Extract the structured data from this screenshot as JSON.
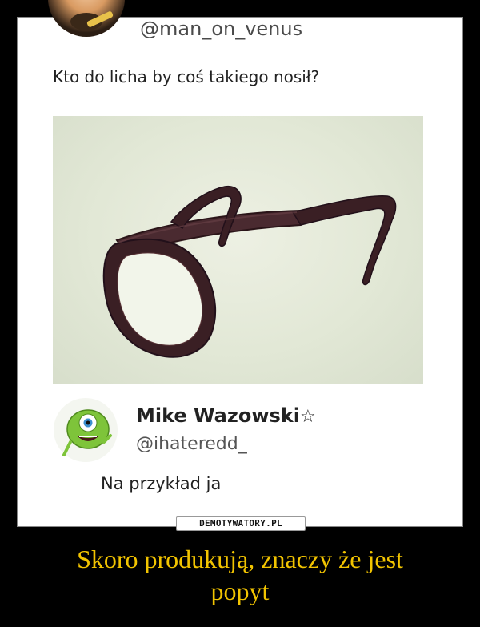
{
  "post": {
    "author_handle": "@man_on_venus",
    "text": "Kto do licha by coś takiego nosił?"
  },
  "reply": {
    "name": "Mike Wazowski",
    "badge": "☆",
    "handle": "@ihateredd_",
    "text": "Na przykład ja"
  },
  "watermark": "DEMOTYWATORY.PL",
  "caption": {
    "line1": "Skoro produkują, znaczy że jest",
    "line2": "popyt"
  },
  "colors": {
    "background": "#000000",
    "caption": "#f2c400",
    "glasses": "#3a1f24"
  },
  "icons": {
    "post_avatar": "person-avatar",
    "reply_avatar": "mike-wazowski-avatar",
    "badge": "star-icon"
  }
}
